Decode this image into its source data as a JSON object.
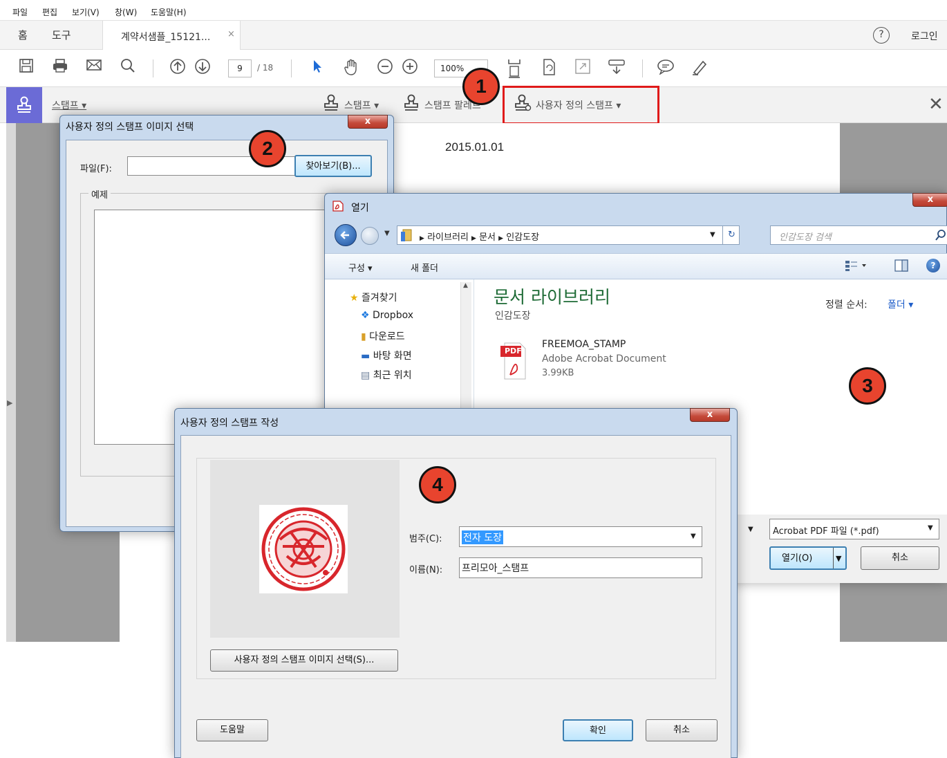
{
  "menu": [
    "파일",
    "편집",
    "보기(V)",
    "창(W)",
    "도움말(H)"
  ],
  "tabs": {
    "home": "홈",
    "tools": "도구",
    "document": "계약서샘플_15121...",
    "close": "×",
    "help": "?",
    "login": "로그인"
  },
  "toolbar": {
    "page_current": "9",
    "page_total": "/ 18",
    "zoom": "100%"
  },
  "stampbar": {
    "left_label": "스탬프 ▾",
    "stamp": "스탬프 ▾",
    "palette": "스탬프 팔레트",
    "custom": "사용자 정의 스탬프 ▾",
    "close": "✕"
  },
  "document": {
    "date": "2015.01.01"
  },
  "badges": [
    "1",
    "2",
    "3",
    "4"
  ],
  "select_image_dialog": {
    "title": "사용자 정의 스탬프 이미지 선택",
    "close": "x",
    "file_label": "파일(F):",
    "file_value": "",
    "browse_button": "찾아보기(B)...",
    "example_label": "예제"
  },
  "open_dialog": {
    "title": "열기",
    "close": "x",
    "breadcrumb": [
      "라이브러리",
      "문서",
      "인감도장"
    ],
    "search_placeholder": "인감도장 검색",
    "organize": "구성 ▾",
    "new_folder": "새 폴더",
    "nav": [
      {
        "label": "즐겨찾기",
        "icon": "star-icon"
      },
      {
        "label": "Dropbox",
        "icon": "dropbox-icon"
      },
      {
        "label": "다운로드",
        "icon": "download-folder-icon"
      },
      {
        "label": "바탕 화면",
        "icon": "desktop-icon"
      },
      {
        "label": "최근 위치",
        "icon": "recent-icon"
      }
    ],
    "library_title": "문서 라이브러리",
    "library_subtitle": "인감도장",
    "sort_label": "정렬 순서:",
    "sort_value": "폴더 ▾",
    "file": {
      "name": "FREEMOA_STAMP",
      "type": "Adobe Acrobat Document",
      "size": "3.99KB",
      "badge": "PDF"
    },
    "filetype": "Acrobat PDF 파일 (*.pdf)",
    "open_button": "열기(O)",
    "cancel_button": "취소"
  },
  "create_dialog": {
    "title": "사용자 정의 스탬프 작성",
    "close": "x",
    "category_label": "범주(C):",
    "category_value": "전자 도장",
    "name_label": "이름(N):",
    "name_value": "프리모아_스탬프",
    "select_image_button": "사용자 정의 스탬프 이미지 선택(S)...",
    "help_button": "도움말",
    "ok_button": "확인",
    "cancel_button": "취소"
  },
  "colors": {
    "accent_stamp": "#6b6bd6",
    "highlight_red": "#e01a1a",
    "badge": "#e8442e",
    "library_title": "#1e6b36",
    "stamp_red": "#d8262c"
  }
}
